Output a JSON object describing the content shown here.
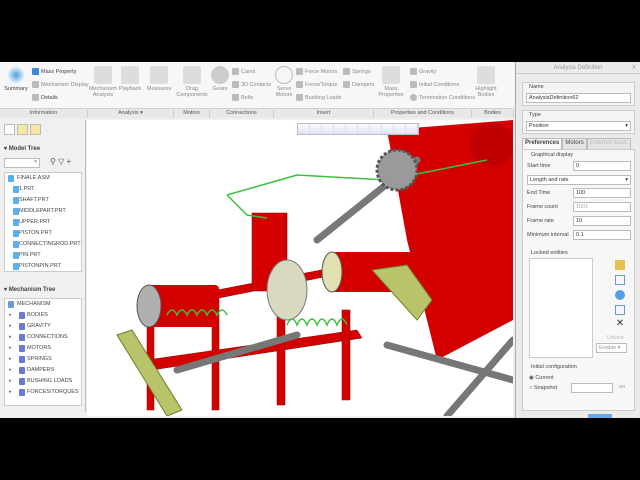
{
  "ribbon": {
    "information": {
      "summary": "Summary",
      "mass_property": "Mass Property",
      "mechanism_display": "Mechanism Display",
      "details": "Details",
      "label": "Information"
    },
    "analysis": {
      "mechanism_analysis": "Mechanism Analysis",
      "playback": "Playback",
      "measures": "Measures",
      "label": "Analysis ▾"
    },
    "motion": {
      "drag_components": "Drag Components",
      "label": "Motion"
    },
    "connections": {
      "gears": "Gears",
      "cams": "Cams",
      "contacts": "3D Contacts",
      "belts": "Belts",
      "label": "Connections"
    },
    "insert": {
      "servo_motors": "Servo Motors",
      "force_motors": "Force Motors",
      "force_torque": "Force/Torque",
      "bushing_loads": "Bushing Loads",
      "springs": "Springs",
      "dampers": "Dampers",
      "label": "Insert"
    },
    "properties": {
      "mass_properties": "Mass Properties",
      "gravity": "Gravity",
      "initial_conditions": "Initial Conditions",
      "termination_conditions": "Termination Conditions",
      "label": "Properties and Conditions"
    },
    "bodies": {
      "highlight_bodies": "Highlight Bodies",
      "label": "Bodies"
    }
  },
  "model_tree": {
    "title": "Model Tree",
    "root": "FINALE.ASM",
    "items": [
      "1.PRT",
      "SHAFT.PRT",
      "MIDDLEPART.PRT",
      "UPPER.PRT",
      "PISTON.PRT",
      "CONNECTINGROD.PRT",
      "PIN.PRT",
      "PISTONPIN.PRT"
    ]
  },
  "mechanism_tree": {
    "title": "Mechanism Tree",
    "root": "MECHANISM",
    "items": [
      "BODIES",
      "GRAVITY",
      "CONNECTIONS",
      "MOTORS",
      "SPRINGS",
      "DAMPERS",
      "BUSHING LOADS",
      "FORCES/TORQUES"
    ]
  },
  "dialog": {
    "title": "Analysis Definition",
    "close": "X",
    "name_label": "Name",
    "name_value": "AnalysisDefinition62",
    "type_label": "Type",
    "type_value": "Position",
    "tabs": [
      "Preferences",
      "Motors",
      "External loads"
    ],
    "graphical_display": "Graphical display",
    "start_time_label": "Start time",
    "start_time": "0",
    "mode": "Length and rate",
    "end_time_label": "End Time",
    "end_time": "100",
    "frame_count_label": "Frame count",
    "frame_count": "1001",
    "frame_rate_label": "Frame rate",
    "frame_rate": "10",
    "min_interval_label": "Minimum interval",
    "min_interval": "0.1",
    "locked_entities": "Locked entities",
    "unlock": "Unlock",
    "enable": "Enable",
    "initial_configuration": "Initial configuration",
    "current": "Current",
    "snapshot": "Snapshot"
  },
  "colors": {
    "part_red": "#d40000",
    "spring_green": "#3fbf3f",
    "accent": "#2a6fb8"
  }
}
